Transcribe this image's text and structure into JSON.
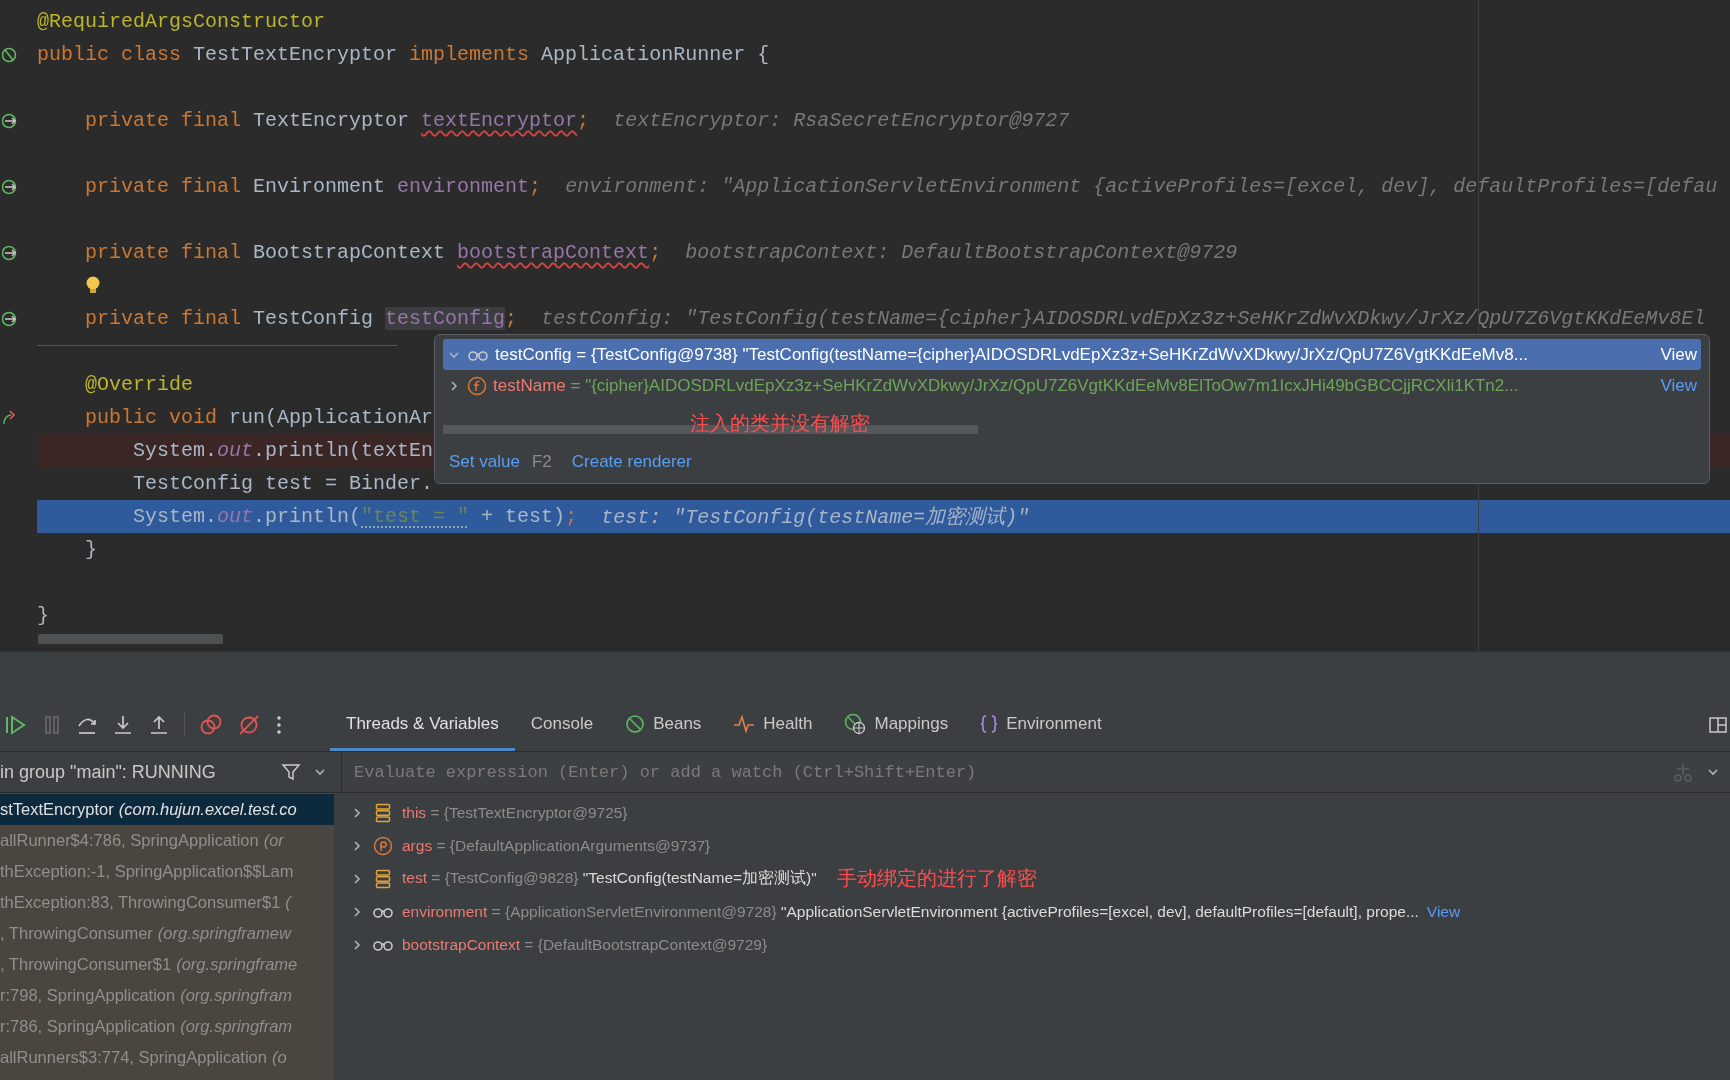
{
  "editor": {
    "lines": [
      {
        "kind": "normal",
        "tokens": [
          {
            "kind": "ann",
            "text": "@RequiredArgsConstructor"
          }
        ]
      },
      {
        "kind": "class_decl",
        "tokens": [
          {
            "kind": "kw",
            "text": "public class "
          },
          {
            "kind": "plain",
            "text": "TestTextEncryptor "
          },
          {
            "kind": "kw",
            "text": "implements "
          },
          {
            "kind": "plain",
            "text": "ApplicationRunner {"
          }
        ]
      },
      {
        "kind": "normal"
      },
      {
        "kind": "field_decl",
        "tokens": [
          {
            "kind": "kw",
            "text": "    private final "
          },
          {
            "kind": "plain",
            "text": "TextEncryptor "
          },
          {
            "kind": "field_err",
            "text": "textEncryptor"
          },
          {
            "kind": "kw",
            "text": ";"
          }
        ],
        "hint": "textEncryptor: RsaSecretEncryptor@9727"
      },
      {
        "kind": "normal"
      },
      {
        "kind": "field_decl",
        "tokens": [
          {
            "kind": "kw",
            "text": "    private final "
          },
          {
            "kind": "plain",
            "text": "Environment "
          },
          {
            "kind": "field",
            "text": "environment"
          },
          {
            "kind": "kw",
            "text": ";"
          }
        ],
        "hint": "environment: \"ApplicationServletEnvironment {activeProfiles=[excel, dev], defaultProfiles=[defau"
      },
      {
        "kind": "normal"
      },
      {
        "kind": "field_decl",
        "tokens": [
          {
            "kind": "kw",
            "text": "    private final "
          },
          {
            "kind": "plain",
            "text": "BootstrapContext "
          },
          {
            "kind": "field_err",
            "text": "bootstrapContext"
          },
          {
            "kind": "kw",
            "text": ";"
          }
        ],
        "hint": "bootstrapContext: DefaultBootstrapContext@9729"
      },
      {
        "kind": "bulb"
      },
      {
        "kind": "field_decl",
        "tokens": [
          {
            "kind": "kw",
            "text": "    private final "
          },
          {
            "kind": "plain",
            "text": "TestConfig "
          },
          {
            "kind": "hl",
            "text": "testConfig"
          },
          {
            "kind": "kw",
            "text": ";"
          }
        ],
        "hint": "testConfig: \"TestConfig(testName={cipher}AIDOSDRLvdEpXz3z+SeHKrZdWvXDkwy/JrXz/QpU7Z6VgtKKdEeMv8El"
      },
      {
        "kind": "separator"
      },
      {
        "kind": "normal",
        "tokens": [
          {
            "kind": "ann",
            "text": "    @Override"
          }
        ]
      },
      {
        "kind": "method_decl",
        "tokens": [
          {
            "kind": "kw",
            "text": "    public void "
          },
          {
            "kind": "plain",
            "text": "run(ApplicationAr"
          }
        ]
      },
      {
        "kind": "breakpoint",
        "tokens": [
          {
            "kind": "plain",
            "text": "        System."
          },
          {
            "kind": "static",
            "text": "out"
          },
          {
            "kind": "plain",
            "text": ".println(textEn"
          }
        ]
      },
      {
        "kind": "normal",
        "tokens": [
          {
            "kind": "plain",
            "text": "        TestConfig test = Binder."
          }
        ]
      },
      {
        "kind": "current",
        "tokens": [
          {
            "kind": "plain",
            "text": "        System."
          },
          {
            "kind": "static",
            "text": "out"
          },
          {
            "kind": "plain",
            "text": ".println("
          },
          {
            "kind": "str_warn",
            "text": "\"test = \""
          },
          {
            "kind": "plain",
            "text": " + test)"
          },
          {
            "kind": "kw",
            "text": ";"
          }
        ],
        "hint": "test: \"TestConfig(testName=加密测试)\""
      },
      {
        "kind": "normal",
        "tokens": [
          {
            "kind": "plain",
            "text": "    }"
          }
        ]
      },
      {
        "kind": "normal"
      },
      {
        "kind": "normal",
        "tokens": [
          {
            "kind": "plain",
            "text": "}"
          }
        ]
      }
    ]
  },
  "popup": {
    "rows": [
      {
        "expanded": true,
        "selected": true,
        "kind": "watch",
        "name": "testConfig",
        "type": " = {TestConfig@9738} ",
        "value": "\"TestConfig(testName={cipher}AIDOSDRLvdEpXz3z+SeHKrZdWvXDkwy/JrXz/QpU7Z6VgtKKdEeMv8...",
        "link": "View"
      },
      {
        "expanded": false,
        "selected": false,
        "kind": "field",
        "name": "testName",
        "type": " = ",
        "value": "\"{cipher}AIDOSDRLvdEpXz3z+SeHKrZdWvXDkwy/JrXz/QpU7Z6VgtKKdEeMv8ElToOw7m1IcxJHi49bGBCCjjRCXli1KTn2...",
        "link": "View"
      }
    ],
    "note": "注入的类并没有解密",
    "actions": [
      {
        "label": "Set value",
        "shortcut": "F2"
      },
      {
        "label": "Create renderer"
      }
    ]
  },
  "debugger": {
    "tabs": [
      {
        "label": "Threads & Variables",
        "selected": true,
        "kind": "plain"
      },
      {
        "label": "Console",
        "selected": false,
        "kind": "plain"
      },
      {
        "label": "Beans",
        "selected": false,
        "kind": "beans"
      },
      {
        "label": "Health",
        "selected": false,
        "kind": "health"
      },
      {
        "label": "Mappings",
        "selected": false,
        "kind": "mappings"
      },
      {
        "label": "Environment",
        "selected": false,
        "kind": "environment"
      }
    ],
    "thread_status": "in group \"main\": RUNNING",
    "evaluate": {
      "placeholder": "Evaluate expression (Enter) or add a watch (Ctrl+Shift+Enter)"
    },
    "frames": [
      {
        "method": "stTextEncryptor",
        "package": "(com.hujun.excel.test.co",
        "selected": true
      },
      {
        "method": "allRunner$4:786, SpringApplication",
        "package": "(or",
        "selected": false
      },
      {
        "method": "thException:-1, SpringApplication$$Lam",
        "selected": false
      },
      {
        "method": "thException:83, ThrowingConsumer$1",
        "package": "(",
        "selected": false
      },
      {
        "method": ", ThrowingConsumer",
        "package": "(org.springframew",
        "selected": false
      },
      {
        "method": ", ThrowingConsumer$1",
        "package": "(org.springframe",
        "selected": false
      },
      {
        "method": "r:798, SpringApplication",
        "package": "(org.springfram",
        "selected": false
      },
      {
        "method": "r:786, SpringApplication",
        "package": "(org.springfram",
        "selected": false
      },
      {
        "method": "allRunners$3:774, SpringApplication",
        "package": "(o",
        "selected": false
      }
    ],
    "variables": [
      {
        "kind": "local",
        "name": "this",
        "type": "{TestTextEncryptor@9725}"
      },
      {
        "kind": "param",
        "name": "args",
        "type": "{DefaultApplicationArguments@9737}"
      },
      {
        "kind": "local",
        "name": "test",
        "type": "{TestConfig@9828}",
        "value": "\"TestConfig(testName=加密测试)\"",
        "note": "手动绑定的进行了解密"
      },
      {
        "kind": "watch",
        "name": "environment",
        "type": "{ApplicationServletEnvironment@9728}",
        "value": "\"ApplicationServletEnvironment {activeProfiles=[excel, dev], defaultProfiles=[default], prope...",
        "link": "View"
      },
      {
        "kind": "watch",
        "name": "bootstrapContext",
        "type": "{DefaultBootstrapContext@9729}"
      }
    ]
  }
}
